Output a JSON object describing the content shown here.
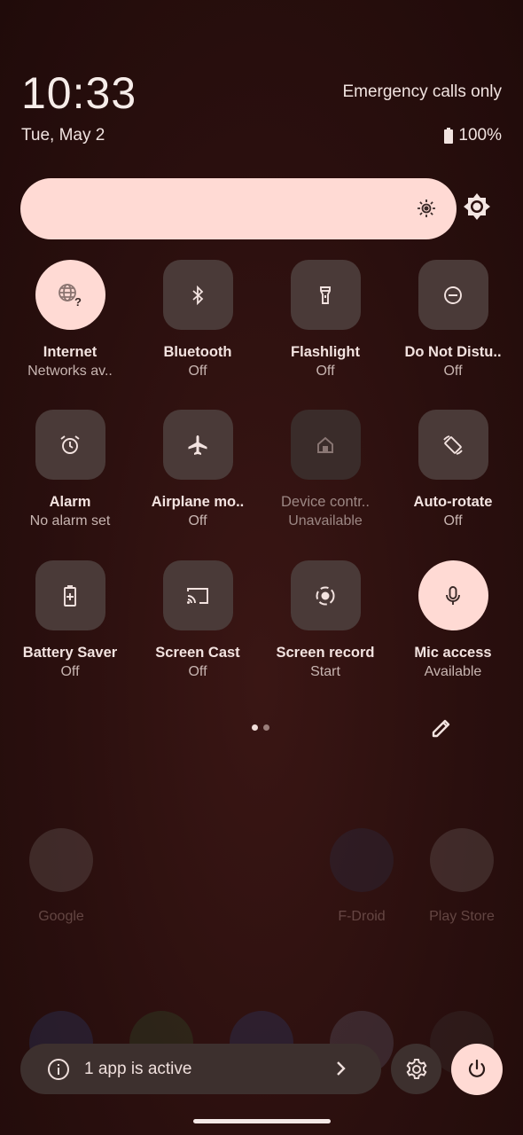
{
  "status": {
    "time": "10:33",
    "date": "Tue, May 2",
    "network": "Emergency calls only",
    "battery": "100%"
  },
  "brightness": {
    "level": 0.85
  },
  "tiles": [
    {
      "id": "internet",
      "label": "Internet",
      "status": "Networks av..",
      "icon": "globe-question-icon",
      "on": true
    },
    {
      "id": "bluetooth",
      "label": "Bluetooth",
      "status": "Off",
      "icon": "bluetooth-icon",
      "on": false
    },
    {
      "id": "flashlight",
      "label": "Flashlight",
      "status": "Off",
      "icon": "flashlight-icon",
      "on": false
    },
    {
      "id": "dnd",
      "label": "Do Not Distu..",
      "status": "Off",
      "icon": "do-not-disturb-icon",
      "on": false
    },
    {
      "id": "alarm",
      "label": "Alarm",
      "status": "No alarm set",
      "icon": "alarm-icon",
      "on": false
    },
    {
      "id": "airplane",
      "label": "Airplane mo..",
      "status": "Off",
      "icon": "airplane-icon",
      "on": false
    },
    {
      "id": "device-controls",
      "label": "Device contr..",
      "status": "Unavailable",
      "icon": "home-icon",
      "on": false,
      "unavailable": true
    },
    {
      "id": "auto-rotate",
      "label": "Auto-rotate",
      "status": "Off",
      "icon": "auto-rotate-icon",
      "on": false
    },
    {
      "id": "battery-saver",
      "label": "Battery Saver",
      "status": "Off",
      "icon": "battery-saver-icon",
      "on": false
    },
    {
      "id": "screen-cast",
      "label": "Screen Cast",
      "status": "Off",
      "icon": "cast-icon",
      "on": false
    },
    {
      "id": "screen-record",
      "label": "Screen record",
      "status": "Start",
      "icon": "screen-record-icon",
      "on": false
    },
    {
      "id": "mic-access",
      "label": "Mic access",
      "status": "Available",
      "icon": "microphone-icon",
      "on": true
    }
  ],
  "pager": {
    "pages": 2,
    "current": 1
  },
  "background_apps": [
    "Google",
    "F-Droid",
    "Play Store"
  ],
  "footer": {
    "active_apps_text": "1 app is active"
  },
  "colors": {
    "accent": "#ffdad4",
    "tile_off": "#4a3a38",
    "background": "#2a0f0e"
  }
}
